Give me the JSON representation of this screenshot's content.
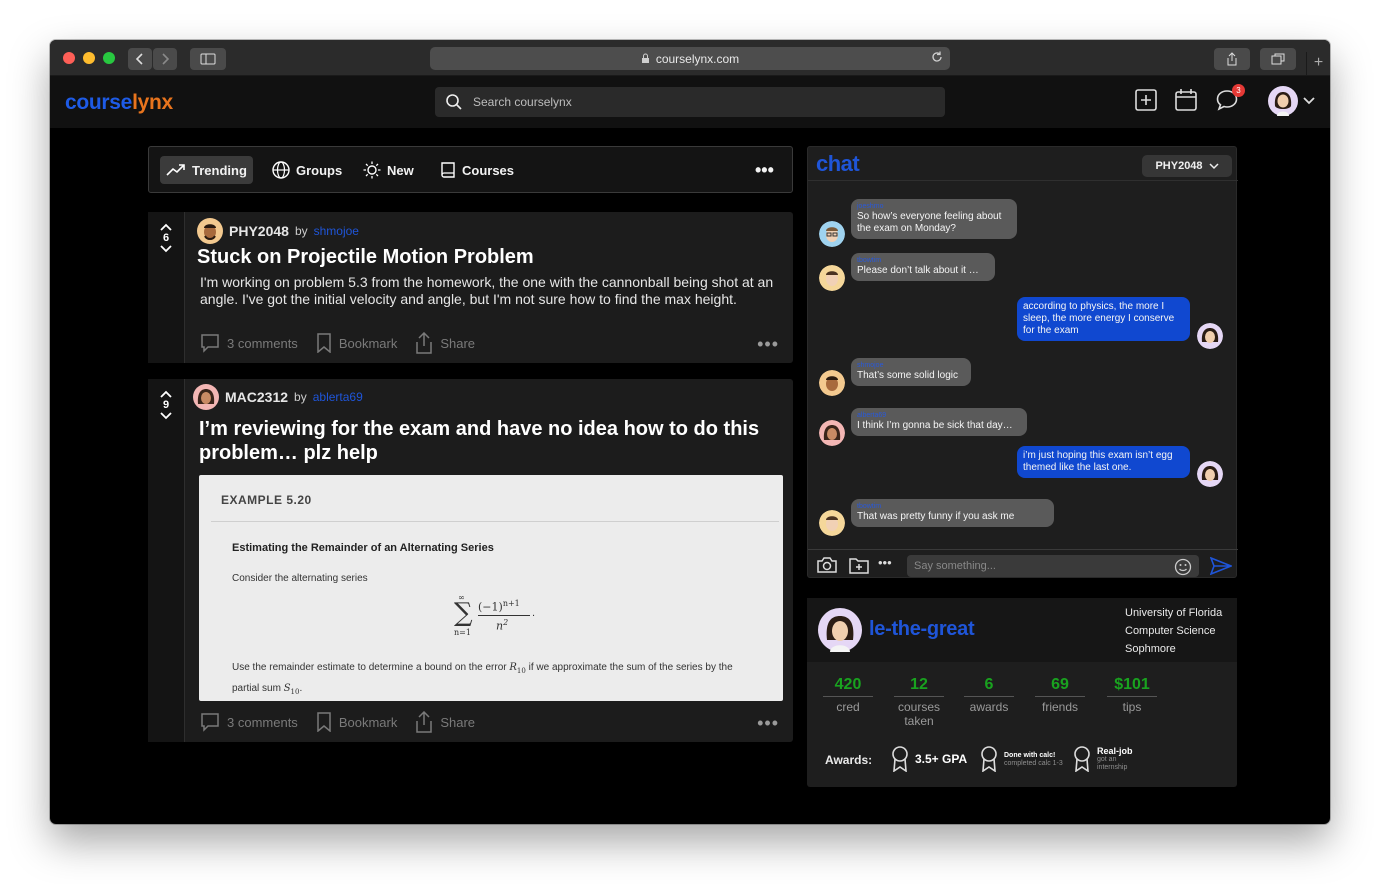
{
  "browser": {
    "url": "courselynx.com"
  },
  "app": {
    "logo_part1": "course",
    "logo_part2": "lynx",
    "search_placeholder": "Search courselynx",
    "notifications_count": "3",
    "colors": {
      "brand_blue": "#1e5be6",
      "brand_orange": "#e8741d",
      "accent_green": "#19a21f",
      "bubble_out": "#1048d0"
    }
  },
  "tabs": [
    {
      "label": "Trending",
      "icon": "trending-icon",
      "active": true
    },
    {
      "label": "Groups",
      "icon": "globe-icon",
      "active": false
    },
    {
      "label": "New",
      "icon": "sun-icon",
      "active": false
    },
    {
      "label": "Courses",
      "icon": "book-icon",
      "active": false
    }
  ],
  "posts": [
    {
      "votes": "6",
      "course": "PHY2048",
      "by": "by",
      "user": "shmojoe",
      "title": "Stuck on Projectile Motion Problem",
      "body": "I'm working on problem 5.3 from the homework, the one with the cannonball being shot at an angle. I've got the initial velocity and angle, but I'm not sure how to find the max height.",
      "comments": "3 comments",
      "bookmark": "Bookmark",
      "share": "Share"
    },
    {
      "votes": "9",
      "course": "MAC2312",
      "by": "by",
      "user": "ablerta69",
      "title": "I’m reviewing for the exam and have no idea how to do this problem… plz help",
      "comments": "3 comments",
      "bookmark": "Bookmark",
      "share": "Share",
      "example": {
        "heading": "EXAMPLE 5.20",
        "title": "Estimating the Remainder of an Alternating Series",
        "consider": "Consider the alternating series",
        "formula_sum_top": "∞",
        "formula_sum_bottom": "n=1",
        "formula_numerator": "(−1)",
        "formula_exponent": "n+1",
        "formula_denominator": "n",
        "formula_denominator_exp": "2",
        "use_text_1": "Use the remainder estimate to determine a bound on the error",
        "use_var_1": "R",
        "use_sub_1": "10",
        "use_text_2": "if we approximate the sum of the",
        "use_text_3": "series by the partial sum",
        "use_var_2": "S",
        "use_sub_2": "10"
      }
    }
  ],
  "chat": {
    "title": "chat",
    "channel": "PHY2048",
    "input_placeholder": "Say something...",
    "messages": [
      {
        "sender": "joeshmo",
        "text": "So how’s everyone feeling about the exam on Monday?",
        "outgoing": false
      },
      {
        "sender": "tbowtim",
        "text": "Please don’t talk about it …",
        "outgoing": false
      },
      {
        "sender": "",
        "text": "according to physics, the more I sleep, the more energy I conserve for the exam",
        "outgoing": true
      },
      {
        "sender": "shmojoe",
        "text": "That’s some solid logic",
        "outgoing": false
      },
      {
        "sender": "alberta69",
        "text": "I think I’m gonna be sick that day…",
        "outgoing": false
      },
      {
        "sender": "",
        "text": "i’m just hoping this exam isn’t egg themed like the last one.",
        "outgoing": true
      },
      {
        "sender": "tbowtim",
        "text": "That was pretty funny if you ask me",
        "outgoing": false
      }
    ]
  },
  "profile": {
    "username": "le-the-great",
    "university": "University of Florida",
    "major": "Computer Science",
    "year": "Sophmore",
    "stats": [
      {
        "value": "420",
        "label": "cred"
      },
      {
        "value": "12",
        "label": "courses taken"
      },
      {
        "value": "6",
        "label": "awards"
      },
      {
        "value": "69",
        "label": "friends"
      },
      {
        "value": "$101",
        "label": "tips"
      }
    ],
    "awards_label": "Awards:",
    "awards": [
      {
        "title": "3.5+ GPA",
        "sub": ""
      },
      {
        "title": "Done with calc!",
        "sub": "completed calc 1-3"
      },
      {
        "title": "Real-job",
        "sub": "got an internship"
      }
    ]
  }
}
